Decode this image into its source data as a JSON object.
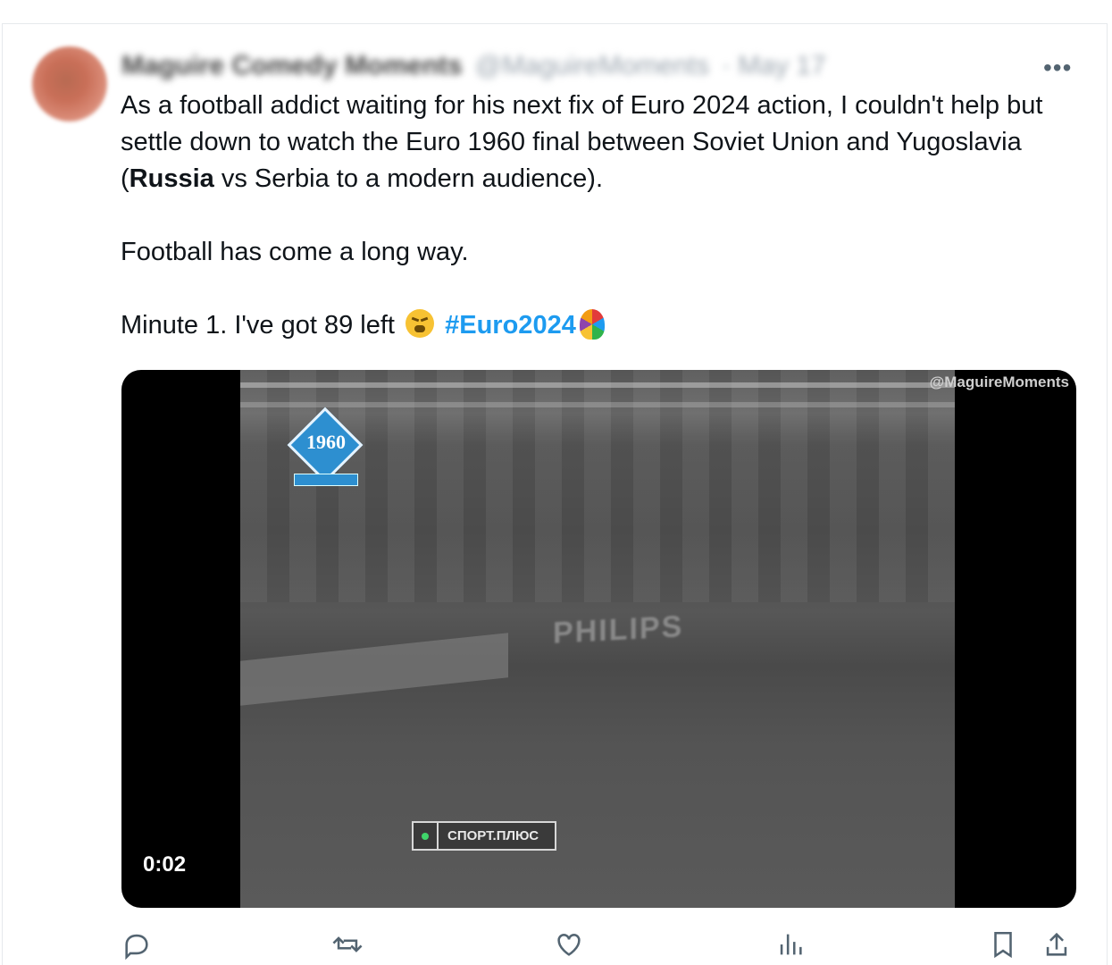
{
  "tweet": {
    "author_name": "Maguire Comedy Moments",
    "author_handle": "@MaguireMoments",
    "date": "· May 17",
    "text_line1": "As a football addict waiting for his next fix of Euro 2024 action, I couldn't help but settle down to watch the Euro 1960 final between Soviet Union and Yugoslavia (",
    "text_bold": "Russia",
    "text_line1_end": " vs Serbia to a modern audience).",
    "text_para2": "Football has come a long way.",
    "text_para3": "Minute 1. I've got 89 left ",
    "hashtag": "#Euro2024",
    "emoji_icon": "weary-face-icon",
    "trophy_icon": "euro-trophy-icon"
  },
  "media": {
    "watermark": "@MaguireMoments",
    "logo_year": "1960",
    "ads_text": "PHILIPS",
    "channel": "СПОРТ.ПЛЮС",
    "timer": "0:02"
  },
  "actions": {
    "icons": [
      "reply-icon",
      "retweet-icon",
      "like-icon",
      "views-icon",
      "bookmark-icon",
      "share-icon"
    ]
  },
  "colors": {
    "hashtag": "#1d9bf0",
    "text": "#0f1419",
    "secondary": "#536471"
  }
}
